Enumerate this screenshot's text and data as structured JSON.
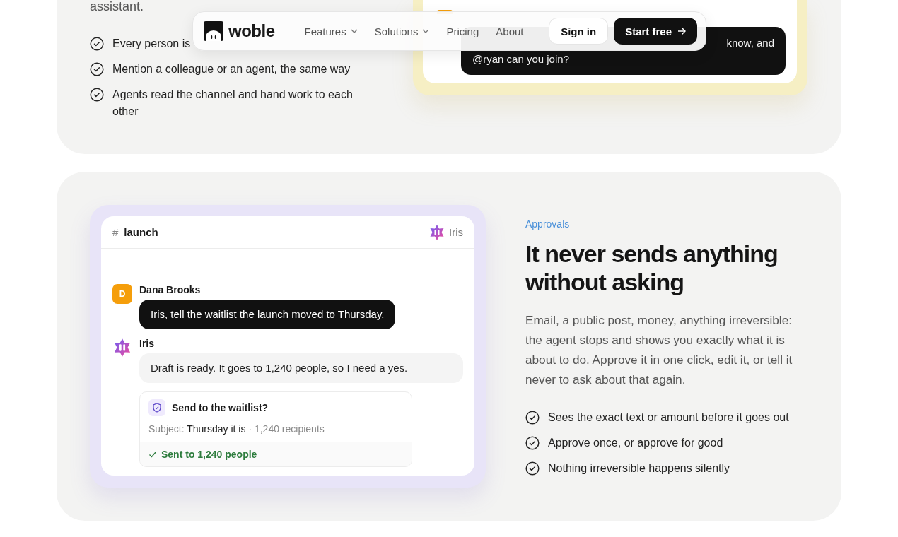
{
  "nav": {
    "brand": "woble",
    "links": [
      {
        "label": "Features",
        "dropdown": true
      },
      {
        "label": "Solutions",
        "dropdown": true
      },
      {
        "label": "Pricing",
        "dropdown": false
      },
      {
        "label": "About",
        "dropdown": false
      }
    ],
    "sign_in": "Sign in",
    "start": "Start free"
  },
  "top_section": {
    "intro_tail": "assistant.",
    "bullets": [
      "Every person is",
      "Mention a colleague or an agent, the same way",
      "Agents read the channel and hand work to each other"
    ],
    "bubble_lines": [
      "know, and",
      "@ryan can you join?"
    ]
  },
  "approvals": {
    "eyebrow": "Approvals",
    "heading": "It never sends anything without asking",
    "body": "Email, a public post, money, anything irreversible: the agent stops and shows you exactly what it is about to do. Approve it in one click, edit it, or tell it never to ask about that again.",
    "bullets": [
      "Sees the exact text or amount before it goes out",
      "Approve once, or approve for good",
      "Nothing irreversible happens silently"
    ],
    "chat": {
      "hash": "#",
      "channel": "launch",
      "agent": "Iris",
      "messages": [
        {
          "kind": "human",
          "initial": "D",
          "author": "Dana Brooks",
          "text": "Iris, tell the waitlist the launch moved to Thursday."
        },
        {
          "kind": "agent",
          "author": "Iris",
          "text": "Draft is ready. It goes to 1,240 people, so I need a yes."
        }
      ],
      "approval": {
        "title": "Send to the waitlist?",
        "subject_label": "Subject:",
        "subject": "Thursday it is",
        "recipients": "· 1,240 recipients",
        "status": "Sent to 1,240 people"
      }
    }
  }
}
